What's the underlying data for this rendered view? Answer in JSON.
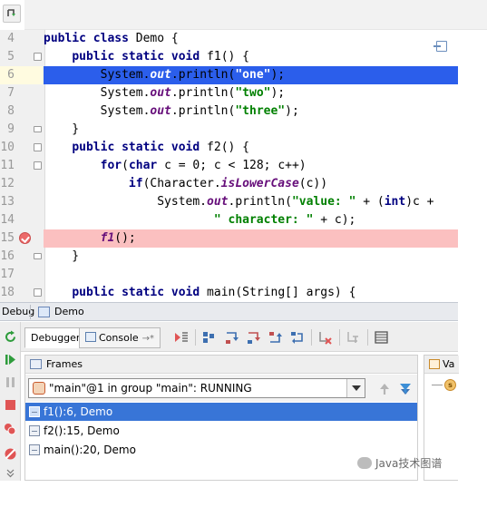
{
  "editor": {
    "lines": [
      {
        "num": "4",
        "tokens": [
          [
            "kw",
            "public "
          ],
          [
            "kw",
            "class "
          ],
          [
            "cls",
            "Demo {"
          ]
        ]
      },
      {
        "num": "5",
        "tokens": [
          [
            "cls",
            "    "
          ],
          [
            "kw",
            "public "
          ],
          [
            "kw",
            "static "
          ],
          [
            "kw",
            "void "
          ],
          [
            "cls",
            "f1() {"
          ]
        ]
      },
      {
        "num": "6",
        "tokens": [
          [
            "cls",
            "        System."
          ],
          [
            "it",
            "out"
          ],
          [
            "cls",
            ".println("
          ],
          [
            "str",
            "\"one\""
          ],
          [
            "cls",
            ");"
          ]
        ]
      },
      {
        "num": "7",
        "tokens": [
          [
            "cls",
            "        System."
          ],
          [
            "it",
            "out"
          ],
          [
            "cls",
            ".println("
          ],
          [
            "str",
            "\"two\""
          ],
          [
            "cls",
            ");"
          ]
        ]
      },
      {
        "num": "8",
        "tokens": [
          [
            "cls",
            "        System."
          ],
          [
            "it",
            "out"
          ],
          [
            "cls",
            ".println("
          ],
          [
            "str",
            "\"three\""
          ],
          [
            "cls",
            ");"
          ]
        ]
      },
      {
        "num": "9",
        "tokens": [
          [
            "cls",
            "    }"
          ]
        ]
      },
      {
        "num": "10",
        "tokens": [
          [
            "cls",
            "    "
          ],
          [
            "kw",
            "public "
          ],
          [
            "kw",
            "static "
          ],
          [
            "kw",
            "void "
          ],
          [
            "cls",
            "f2() {"
          ]
        ]
      },
      {
        "num": "11",
        "tokens": [
          [
            "cls",
            "        "
          ],
          [
            "kw",
            "for"
          ],
          [
            "cls",
            "("
          ],
          [
            "kw",
            "char "
          ],
          [
            "cls",
            "c = "
          ],
          [
            "cls",
            "0"
          ],
          [
            "cls",
            "; c < "
          ],
          [
            "cls",
            "128"
          ],
          [
            "cls",
            "; c++)"
          ]
        ]
      },
      {
        "num": "12",
        "tokens": [
          [
            "cls",
            "            "
          ],
          [
            "kw",
            "if"
          ],
          [
            "cls",
            "(Character."
          ],
          [
            "it",
            "isLowerCase"
          ],
          [
            "cls",
            "(c))"
          ]
        ]
      },
      {
        "num": "13",
        "tokens": [
          [
            "cls",
            "                System."
          ],
          [
            "it",
            "out"
          ],
          [
            "cls",
            ".println("
          ],
          [
            "str",
            "\"value: \""
          ],
          [
            "cls",
            " + ("
          ],
          [
            "kw",
            "int"
          ],
          [
            "cls",
            ")c +"
          ]
        ]
      },
      {
        "num": "14",
        "tokens": [
          [
            "cls",
            "                        "
          ],
          [
            "str",
            "\" character: \""
          ],
          [
            "cls",
            " + c);"
          ]
        ]
      },
      {
        "num": "15",
        "tokens": [
          [
            "cls",
            "        "
          ],
          [
            "it",
            "f1"
          ],
          [
            "cls",
            "();"
          ]
        ]
      },
      {
        "num": "16",
        "tokens": [
          [
            "cls",
            "    }"
          ]
        ]
      },
      {
        "num": "17",
        "tokens": []
      },
      {
        "num": "18",
        "tokens": [
          [
            "cls",
            "    "
          ],
          [
            "kw",
            "public "
          ],
          [
            "kw",
            "static "
          ],
          [
            "kw",
            "void "
          ],
          [
            "cls",
            "main(String[] args) {"
          ]
        ]
      }
    ]
  },
  "debug_header": {
    "title": "Debug",
    "tab_label": "Demo"
  },
  "tabs": {
    "debugger_label": "Debugger",
    "console_label": "Console",
    "console_pin": "→*"
  },
  "frames": {
    "header": "Frames",
    "thread": "\"main\"@1 in group \"main\": RUNNING",
    "items": [
      "f1():6, Demo",
      "f2():15, Demo",
      "main():20, Demo"
    ]
  },
  "variables": {
    "header": "Va"
  },
  "watermark": "Java技术图谱",
  "colors": {
    "exec_line": "#2b5eeb",
    "breakpoint_line": "#fbc0c0",
    "selected_frame": "#3875d7",
    "keyword": "#000080",
    "string": "#008000",
    "italic_member": "#660e7a"
  }
}
